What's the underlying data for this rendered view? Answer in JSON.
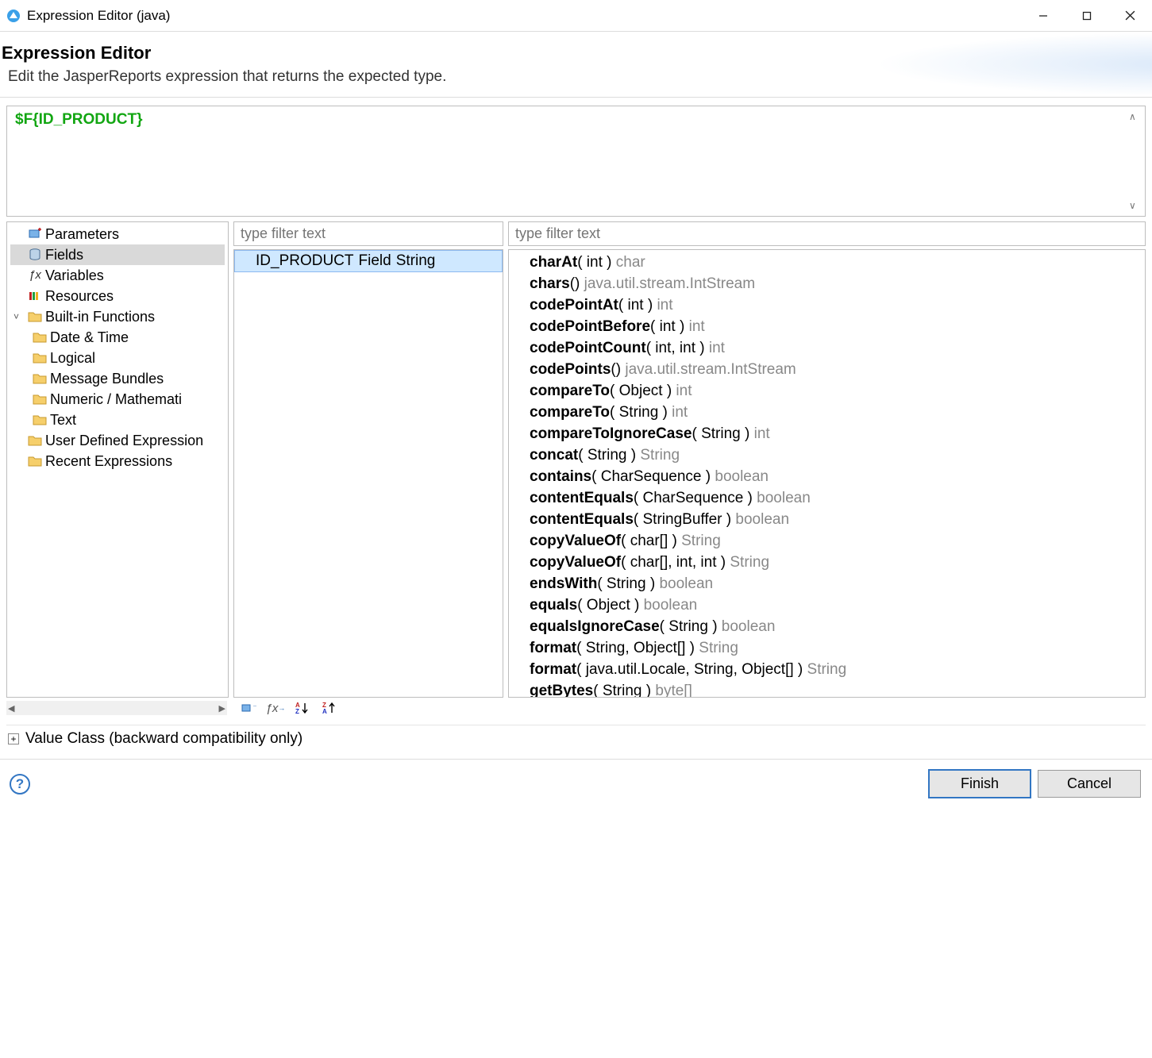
{
  "window": {
    "title": "Expression Editor (java)"
  },
  "header": {
    "title": "Expression Editor",
    "subtitle": "Edit the JasperReports expression that returns the expected type."
  },
  "expression": {
    "value": "$F{ID_PRODUCT}"
  },
  "filters": {
    "mid_placeholder": "type filter text",
    "right_placeholder": "type filter text"
  },
  "tree": {
    "items": [
      {
        "label": "Parameters",
        "icon": "params-icon",
        "depth": 0
      },
      {
        "label": "Fields",
        "icon": "db-icon",
        "depth": 0,
        "selected": true
      },
      {
        "label": "Variables",
        "icon": "fx-icon",
        "depth": 0
      },
      {
        "label": "Resources",
        "icon": "resource-icon",
        "depth": 0
      },
      {
        "label": "Built-in Functions",
        "icon": "folder-icon",
        "depth": 0,
        "expanded": true,
        "twisty": "v"
      },
      {
        "label": "Date & Time",
        "icon": "folder-icon",
        "depth": 1
      },
      {
        "label": "Logical",
        "icon": "folder-icon",
        "depth": 1
      },
      {
        "label": "Message Bundles",
        "icon": "folder-icon",
        "depth": 1
      },
      {
        "label": "Numeric / Mathematical",
        "icon": "folder-icon",
        "depth": 1,
        "clipped": "Numeric / Mathemati"
      },
      {
        "label": "Text",
        "icon": "folder-icon",
        "depth": 1
      },
      {
        "label": "User Defined Expressions",
        "icon": "folder-icon",
        "depth": 0,
        "clipped": "User Defined Expression"
      },
      {
        "label": "Recent Expressions",
        "icon": "folder-icon",
        "depth": 0
      }
    ]
  },
  "mid_list": {
    "selected": {
      "name": "ID_PRODUCT",
      "kind": "Field",
      "type": "String"
    }
  },
  "methods": [
    {
      "name": "charAt",
      "sig": "( int )",
      "ret": "char"
    },
    {
      "name": "chars",
      "sig": "()",
      "ret": "java.util.stream.IntStream"
    },
    {
      "name": "codePointAt",
      "sig": "( int )",
      "ret": "int"
    },
    {
      "name": "codePointBefore",
      "sig": "( int )",
      "ret": "int"
    },
    {
      "name": "codePointCount",
      "sig": "( int, int )",
      "ret": "int"
    },
    {
      "name": "codePoints",
      "sig": "()",
      "ret": "java.util.stream.IntStream"
    },
    {
      "name": "compareTo",
      "sig": "( Object )",
      "ret": "int"
    },
    {
      "name": "compareTo",
      "sig": "( String )",
      "ret": "int"
    },
    {
      "name": "compareToIgnoreCase",
      "sig": "( String )",
      "ret": "int"
    },
    {
      "name": "concat",
      "sig": "( String )",
      "ret": "String"
    },
    {
      "name": "contains",
      "sig": "( CharSequence )",
      "ret": "boolean"
    },
    {
      "name": "contentEquals",
      "sig": "( CharSequence )",
      "ret": "boolean"
    },
    {
      "name": "contentEquals",
      "sig": "( StringBuffer )",
      "ret": "boolean"
    },
    {
      "name": "copyValueOf",
      "sig": "( char[] )",
      "ret": "String"
    },
    {
      "name": "copyValueOf",
      "sig": "( char[], int, int )",
      "ret": "String"
    },
    {
      "name": "endsWith",
      "sig": "( String )",
      "ret": "boolean"
    },
    {
      "name": "equals",
      "sig": "( Object )",
      "ret": "boolean"
    },
    {
      "name": "equalsIgnoreCase",
      "sig": "( String )",
      "ret": "boolean"
    },
    {
      "name": "format",
      "sig": "( String, Object[] )",
      "ret": "String"
    },
    {
      "name": "format",
      "sig": "( java.util.Locale, String, Object[] )",
      "ret": "String"
    },
    {
      "name": "getBytes",
      "sig": "( String )",
      "ret": "byte[]"
    }
  ],
  "expando": {
    "label": "Value Class (backward compatibility only)"
  },
  "footer": {
    "finish": "Finish",
    "cancel": "Cancel"
  }
}
